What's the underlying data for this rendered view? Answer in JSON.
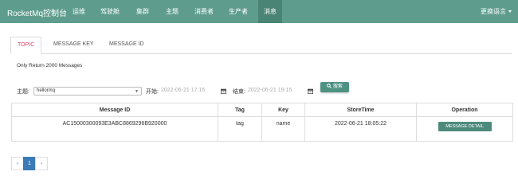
{
  "navbar": {
    "brand": "RocketMq控制台",
    "items": [
      {
        "label": "运维"
      },
      {
        "label": "驾驶舱"
      },
      {
        "label": "集群"
      },
      {
        "label": "主题"
      },
      {
        "label": "消费者"
      },
      {
        "label": "生产者"
      },
      {
        "label": "消息"
      }
    ],
    "active_item": "消息",
    "language": "更换语言"
  },
  "tabs": [
    {
      "label": "TOPIC"
    },
    {
      "label": "MESSAGE KEY"
    },
    {
      "label": "MESSAGE ID"
    }
  ],
  "active_tab": "TOPIC",
  "note": "Only Return 2000 Messages",
  "query": {
    "topic_label": "主题:",
    "topic_value": "hellormq",
    "start_label": "开始:",
    "start_value": "2022-06-21 17:15",
    "end_label": "结束:",
    "end_value": "2022-06-21 19:15",
    "search_label": "搜索"
  },
  "table": {
    "headers": [
      "Message ID",
      "Tag",
      "Key",
      "StoreTime",
      "Operation"
    ],
    "rows": [
      {
        "message_id": "AC15000300093E3ABC8869296B920000",
        "tag": "tag",
        "key": "name",
        "store_time": "2022-06-21 18:05:22",
        "operation": "MESSAGE DETAIL"
      }
    ]
  },
  "pagination": {
    "prev": "‹",
    "pages": [
      "1"
    ],
    "current": "1",
    "next": "›"
  },
  "colors": {
    "navbar": "#5e9d8d",
    "navbar_active": "#4a8474",
    "tab_active": "#e0456b",
    "button": "#4e8a7c",
    "page_active": "#3a7bb8"
  }
}
